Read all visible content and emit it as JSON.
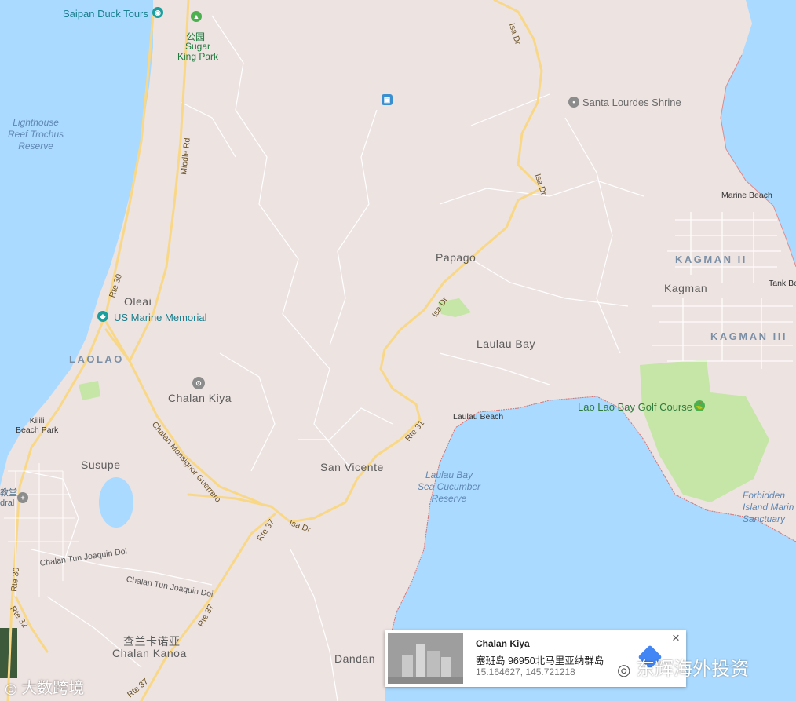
{
  "places": {
    "oleai": "Oleai",
    "laolao": "LAOLAO",
    "chalan_kiya": "Chalan Kiya",
    "susupe": "Susupe",
    "san_vicente": "San Vicente",
    "papago": "Papago",
    "laulau_bay": "Laulau Bay",
    "kagman": "Kagman",
    "kagman_ii": "KAGMAN II",
    "kagman_iii": "KAGMAN III",
    "dandan": "Dandan",
    "chalan_kanoa": "Chalan Kanoa",
    "chalan_kanoa_cn": "查兰卡诺亚",
    "kilili": "Kilili\nBeach Park"
  },
  "pois": {
    "duck_tours": "Saipan Duck Tours",
    "park_cn": "公园",
    "sugar_king": "Sugar\nKing Park",
    "santa_lourdes": "Santa Lourdes Shrine",
    "us_marine": "US Marine Memorial",
    "golf": "Lao Lao Bay Golf Course",
    "marine_beach": "Marine Beach",
    "laulau_beach": "Laulau Beach",
    "tank_beach": "Tank Be",
    "forbidden_island": "Forbidden\nIsland Marin\nSanctuary",
    "church_left": "教堂\ndral"
  },
  "water": {
    "lighthouse": "Lighthouse\nReef Trochus\nReserve",
    "laulau_reserve": "Laulau Bay\nSea Cucumber\nReserve"
  },
  "roads": {
    "isa_dr": "Isa Dr",
    "middle_rd": "Middle Rd",
    "rte30": "Rte 30",
    "rte31": "Rte 31",
    "rte37": "Rte 37",
    "rte32": "Rte 32",
    "monsignor": "Chalan Monsignor Guerrero",
    "tun_joaquin": "Chalan Tun Joaquin Doi"
  },
  "card": {
    "title": "Chalan Kiya",
    "address": "塞班岛 96950北马里亚纳群岛",
    "coords": "15.164627, 145.721218",
    "close": "×"
  },
  "watermarks": {
    "left": "大数跨境",
    "right": "东辉海外投资"
  },
  "colors": {
    "land": "#ede3e1",
    "water": "#aadaff",
    "road": "#f8d887",
    "park": "#c5e6a6",
    "accent_teal": "#1a9e9e"
  }
}
